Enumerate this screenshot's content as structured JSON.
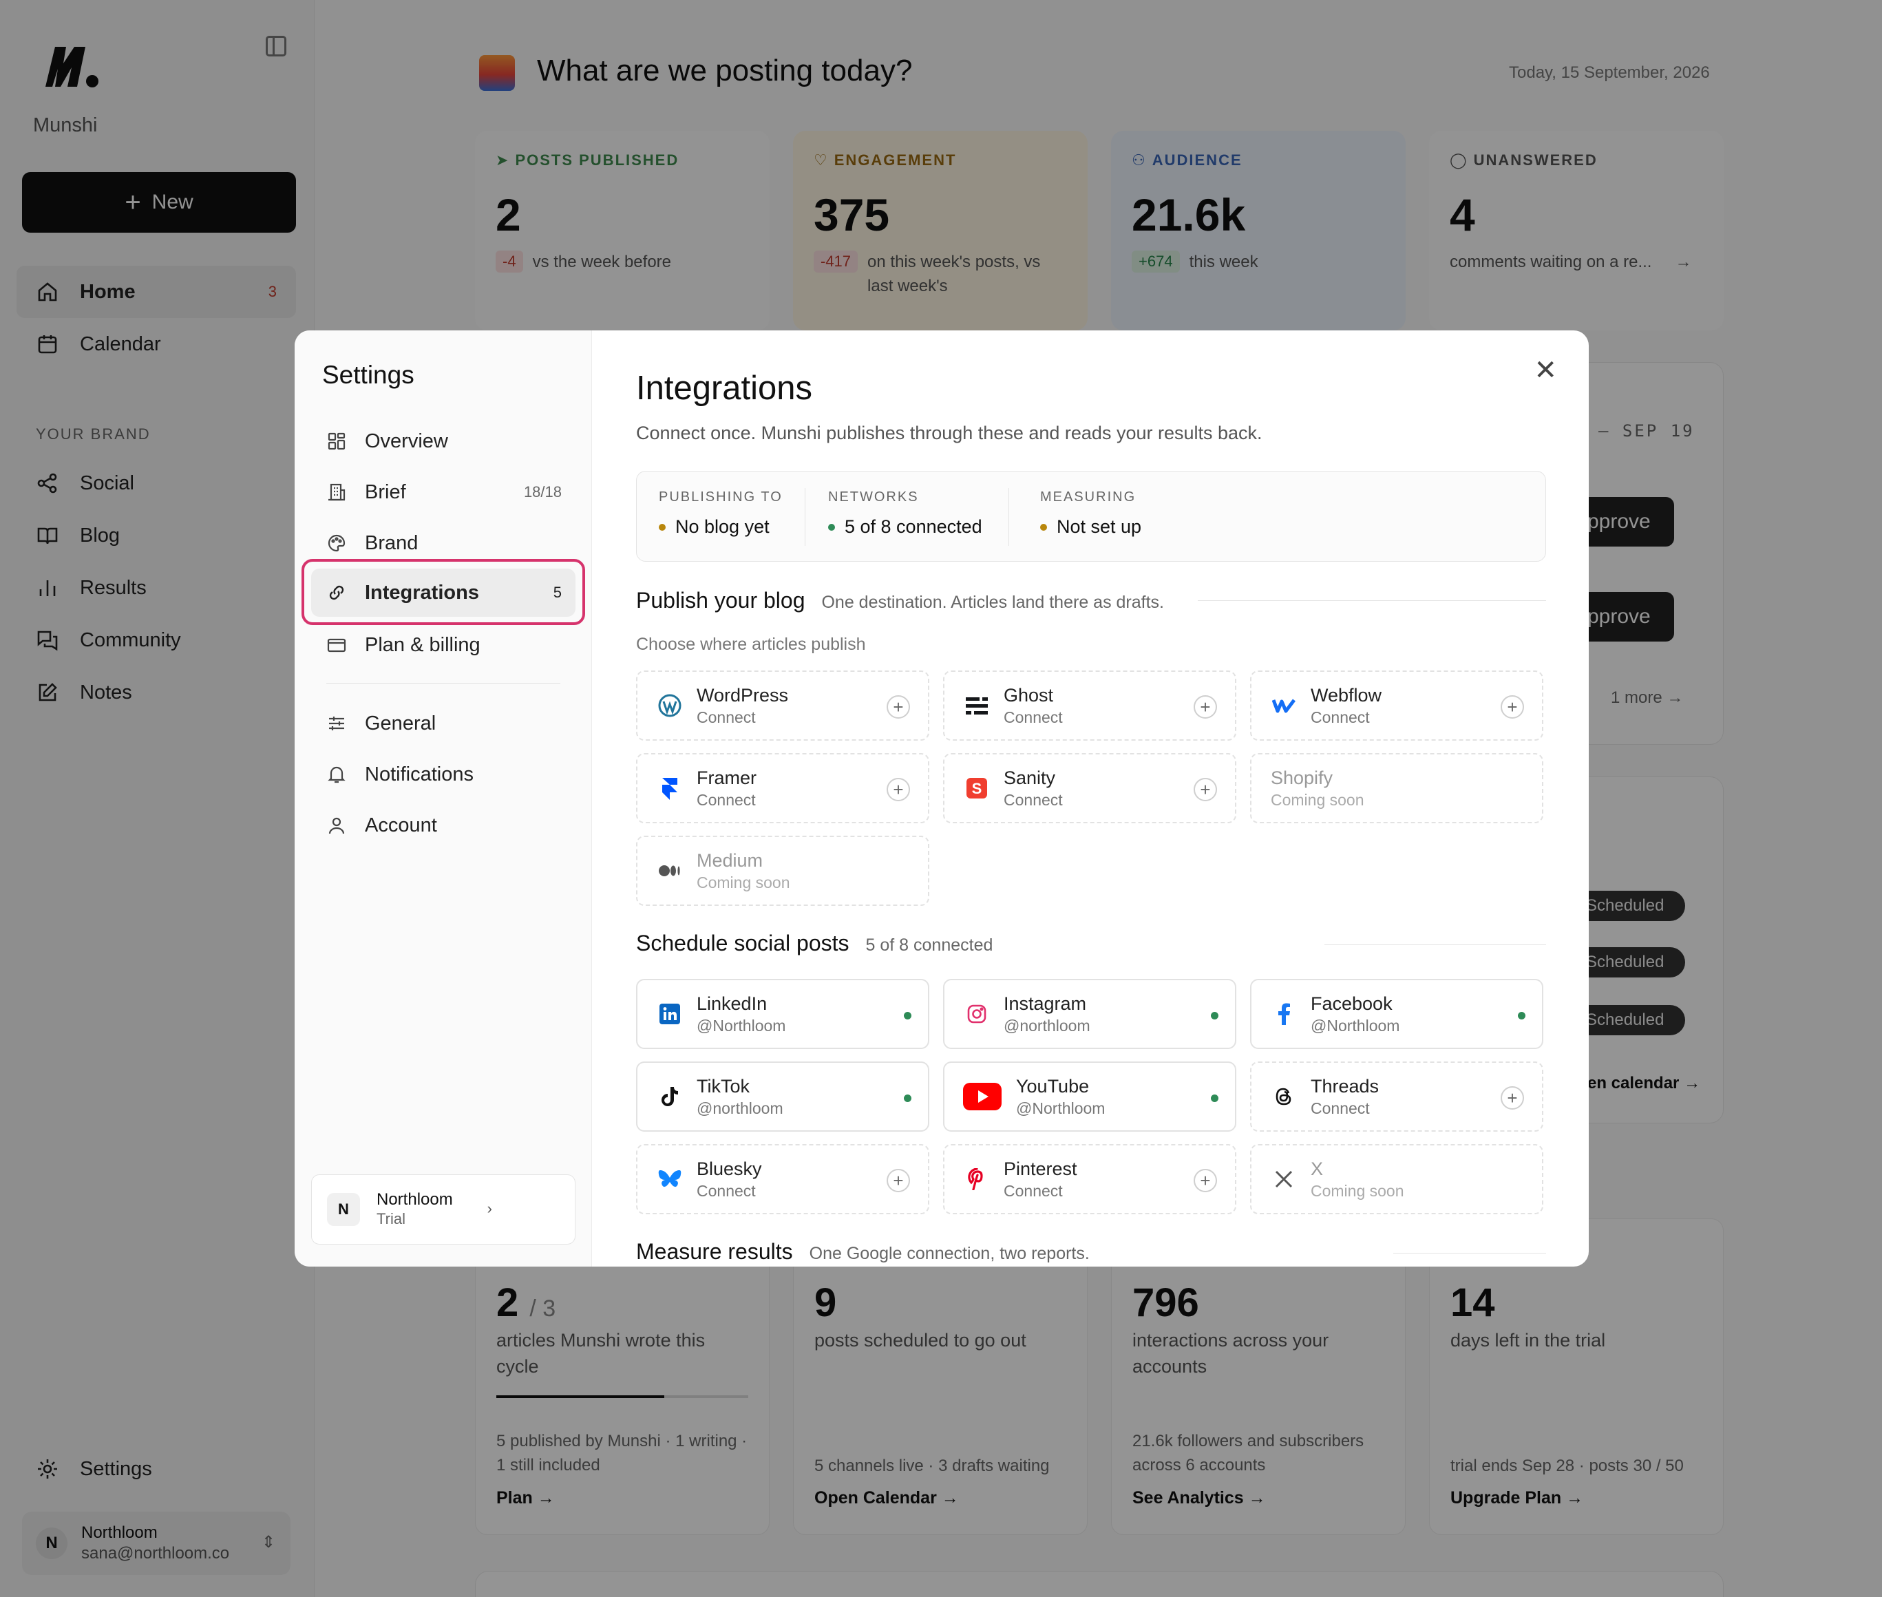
{
  "app": {
    "brand_name": "Munshi",
    "new_label": "New"
  },
  "sidebar": {
    "items": [
      {
        "label": "Home",
        "badge": "3",
        "icon": "home-icon"
      },
      {
        "label": "Calendar",
        "icon": "calendar-icon"
      }
    ],
    "section_label": "YOUR BRAND",
    "brand_items": [
      {
        "label": "Social",
        "icon": "share-icon"
      },
      {
        "label": "Blog",
        "icon": "book-icon"
      },
      {
        "label": "Results",
        "icon": "bar-chart-icon"
      },
      {
        "label": "Community",
        "icon": "chat-icon"
      },
      {
        "label": "Notes",
        "icon": "edit-icon"
      }
    ],
    "settings_label": "Settings",
    "user": {
      "initial": "N",
      "name": "Northloom",
      "email": "sana@northloom.co"
    }
  },
  "main": {
    "title": "What are we posting today?",
    "date": "Today, 15 September, 2026",
    "stats": [
      {
        "label": "POSTS PUBLISHED",
        "value": "2",
        "delta": "-4",
        "note": "vs the week before",
        "color": "#3f8a4f"
      },
      {
        "label": "ENGAGEMENT",
        "value": "375",
        "delta": "-417",
        "note": "on this week's posts, vs last week's",
        "color": "#9a6a12"
      },
      {
        "label": "AUDIENCE",
        "value": "21.6k",
        "delta": "+674",
        "note": "this week",
        "color": "#3a67b7"
      },
      {
        "label": "UNANSWERED",
        "value": "4",
        "note": "comments waiting on a re...",
        "color": "#555555"
      }
    ],
    "peek": {
      "range": "– SEP 19",
      "approve_1": "pprove",
      "approve_2": "pprove",
      "more": "1 more",
      "scheduled": [
        "Scheduled",
        "Scheduled",
        "Scheduled"
      ],
      "calendar_link": "en calendar →"
    },
    "bottom_stats": [
      {
        "big": "2",
        "big_small": "/ 3",
        "desc": "articles Munshi wrote this cycle",
        "foot": "5 published by Munshi · 1 writing · 1 still included",
        "link": "Plan →",
        "progress": 0.667
      },
      {
        "big": "9",
        "desc": "posts scheduled to go out",
        "foot": "5 channels live · 3 drafts waiting",
        "link": "Open Calendar →"
      },
      {
        "big": "796",
        "desc": "interactions across your accounts",
        "foot": "21.6k followers and subscribers across 6 accounts",
        "link": "See Analytics →"
      },
      {
        "big": "14",
        "desc": "days left in the trial",
        "foot": "trial ends Sep 28 · posts 30 / 50",
        "link": "Upgrade Plan →"
      }
    ]
  },
  "settings_modal": {
    "title": "Settings",
    "nav": [
      {
        "label": "Overview",
        "icon": "grid-icon"
      },
      {
        "label": "Brief",
        "count": "18/18",
        "icon": "building-icon"
      },
      {
        "label": "Brand",
        "icon": "palette-icon"
      },
      {
        "label": "Integrations",
        "count": "5",
        "icon": "link-icon",
        "active": true
      },
      {
        "label": "Plan & billing",
        "icon": "card-icon"
      },
      {
        "label": "General",
        "icon": "sliders-icon"
      },
      {
        "label": "Notifications",
        "icon": "bell-icon"
      },
      {
        "label": "Account",
        "icon": "user-icon"
      }
    ],
    "workspace": {
      "initial": "N",
      "name": "Northloom",
      "status": "Trial"
    },
    "integrations": {
      "title": "Integrations",
      "description": "Connect once. Munshi publishes through these and reads your results back.",
      "status": [
        {
          "heading": "PUBLISHING TO",
          "value": "No blog yet",
          "state": "amber"
        },
        {
          "heading": "NETWORKS",
          "value": "5 of 8 connected",
          "state": "green"
        },
        {
          "heading": "MEASURING",
          "value": "Not set up",
          "state": "amber"
        }
      ],
      "blog_section": {
        "title": "Publish your blog",
        "subtitle": "One destination. Articles land there as drafts.",
        "choose": "Choose where articles publish",
        "tiles": [
          {
            "name": "WordPress",
            "status": "Connect",
            "icon": "wordpress-icon",
            "color": "#21759b"
          },
          {
            "name": "Ghost",
            "status": "Connect",
            "icon": "ghost-icon",
            "color": "#15171a"
          },
          {
            "name": "Webflow",
            "status": "Connect",
            "icon": "webflow-icon",
            "color": "#146ef5"
          },
          {
            "name": "Framer",
            "status": "Connect",
            "icon": "framer-icon",
            "color": "#0055ff"
          },
          {
            "name": "Sanity",
            "status": "Connect",
            "icon": "sanity-icon",
            "color": "#f03e2f"
          },
          {
            "name": "Shopify",
            "status": "Coming soon",
            "icon": "none"
          },
          {
            "name": "Medium",
            "status": "Coming soon",
            "icon": "medium-icon",
            "color": "#555555"
          }
        ]
      },
      "social_section": {
        "title": "Schedule social posts",
        "subtitle": "5 of 8 connected",
        "tiles": [
          {
            "name": "LinkedIn",
            "status": "@Northloom",
            "icon": "linkedin-icon",
            "color": "#0a66c2",
            "connected": true
          },
          {
            "name": "Instagram",
            "status": "@northloom",
            "icon": "instagram-icon",
            "color": "#e1306c",
            "connected": true
          },
          {
            "name": "Facebook",
            "status": "@Northloom",
            "icon": "facebook-icon",
            "color": "#1877f2",
            "connected": true
          },
          {
            "name": "TikTok",
            "status": "@northloom",
            "icon": "tiktok-icon",
            "color": "#111111",
            "connected": true
          },
          {
            "name": "YouTube",
            "status": "@Northloom",
            "icon": "youtube-icon",
            "color": "#ff0000",
            "connected": true
          },
          {
            "name": "Threads",
            "status": "Connect",
            "icon": "threads-icon",
            "color": "#111111"
          },
          {
            "name": "Bluesky",
            "status": "Connect",
            "icon": "bluesky-icon",
            "color": "#1185fe"
          },
          {
            "name": "Pinterest",
            "status": "Connect",
            "icon": "pinterest-icon",
            "color": "#e60023"
          },
          {
            "name": "X",
            "status": "Coming soon",
            "icon": "x-icon",
            "color": "#555555"
          }
        ]
      },
      "measure_section": {
        "title": "Measure results",
        "subtitle": "One Google connection, two reports."
      }
    }
  }
}
